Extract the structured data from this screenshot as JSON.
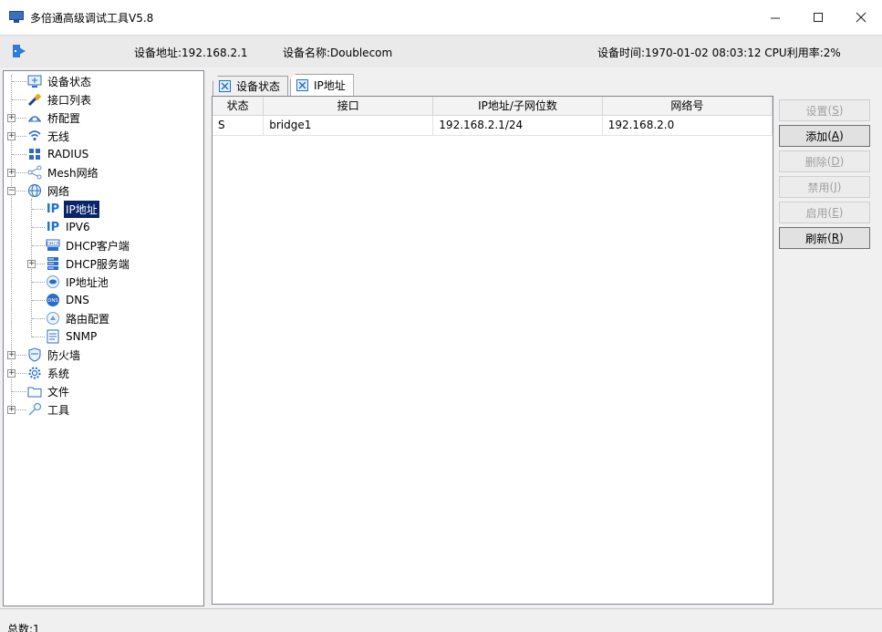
{
  "window": {
    "title": "多倍通高级调试工具V5.8",
    "minimize_glyph": "—",
    "maximize_glyph": "☐",
    "close_glyph": "✕"
  },
  "infobar": {
    "device_address": "设备地址:192.168.2.1",
    "device_name": "设备名称:Doublecom",
    "device_time_cpu": "设备时间:1970-01-02 08:03:12 CPU利用率:2%"
  },
  "tree": {
    "items": [
      {
        "label": "设备状态",
        "icon": "monitor-icon"
      },
      {
        "label": "接口列表",
        "icon": "cable-icon"
      },
      {
        "label": "桥配置",
        "icon": "bridge-icon"
      },
      {
        "label": "无线",
        "icon": "wifi-icon"
      },
      {
        "label": "RADIUS",
        "icon": "radius-icon"
      },
      {
        "label": "Mesh网络",
        "icon": "mesh-icon"
      },
      {
        "label": "网络",
        "icon": "globe-icon"
      },
      {
        "label": "IP地址",
        "icon": "ip-icon"
      },
      {
        "label": "IPV6",
        "icon": "ip-icon"
      },
      {
        "label": "DHCP客户端",
        "icon": "dhcp-icon"
      },
      {
        "label": "DHCP服务端",
        "icon": "server-icon"
      },
      {
        "label": "IP地址池",
        "icon": "pool-icon"
      },
      {
        "label": "DNS",
        "icon": "dns-icon"
      },
      {
        "label": "路由配置",
        "icon": "route-icon"
      },
      {
        "label": "SNMP",
        "icon": "snmp-icon"
      },
      {
        "label": "防火墙",
        "icon": "shield-icon"
      },
      {
        "label": "系统",
        "icon": "gear-icon"
      },
      {
        "label": "文件",
        "icon": "folder-icon"
      },
      {
        "label": "工具",
        "icon": "key-icon"
      }
    ]
  },
  "tabs": [
    {
      "label": "设备状态"
    },
    {
      "label": "IP地址"
    }
  ],
  "table": {
    "columns": [
      "状态",
      "接口",
      "IP地址/子网位数",
      "网络号"
    ],
    "rows": [
      [
        "S",
        "bridge1",
        "192.168.2.1/24",
        "192.168.2.0"
      ]
    ]
  },
  "buttons": {
    "set": {
      "label": "设置",
      "key": "S"
    },
    "add": {
      "label": "添加",
      "key": "A"
    },
    "delete": {
      "label": "删除",
      "key": "D"
    },
    "disable": {
      "label": "禁用",
      "key": "J"
    },
    "enable": {
      "label": "启用",
      "key": "E"
    },
    "refresh": {
      "label": "刷新",
      "key": "R"
    }
  },
  "status": {
    "total": "总数:1"
  },
  "colors": {
    "selection": "#0a246a",
    "ip_icon": "#1f6fd0"
  }
}
